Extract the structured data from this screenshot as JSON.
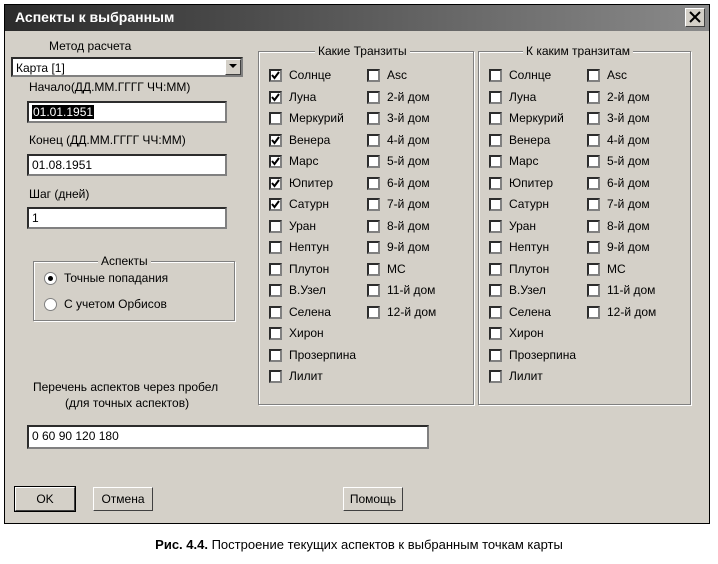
{
  "window": {
    "title": "Аспекты к выбранным"
  },
  "method": {
    "label": "Метод расчета",
    "value": "Карта [1]"
  },
  "start": {
    "label": "Начало(ДД.ММ.ГГГГ ЧЧ:ММ)",
    "value": "01.01.1951"
  },
  "end": {
    "label": "Конец (ДД.ММ.ГГГГ ЧЧ:ММ)",
    "value": "01.08.1951"
  },
  "step": {
    "label": "Шаг (дней)",
    "value": "1"
  },
  "aspects": {
    "title": "Аспекты",
    "options": [
      {
        "label": "Точные попадания",
        "selected": true
      },
      {
        "label": "С учетом Орбисов",
        "selected": false
      }
    ]
  },
  "aspect_list": {
    "label1": "Перечень аспектов через пробел",
    "label2": "(для точных аспектов)",
    "value": "0 60 90 120  180"
  },
  "transits": {
    "title": "Какие Транзиты",
    "col1": [
      {
        "label": "Солнце",
        "checked": true
      },
      {
        "label": "Луна",
        "checked": true
      },
      {
        "label": "Меркурий",
        "checked": false
      },
      {
        "label": "Венера",
        "checked": true
      },
      {
        "label": "Марс",
        "checked": true
      },
      {
        "label": "Юпитер",
        "checked": true
      },
      {
        "label": "Сатурн",
        "checked": true
      },
      {
        "label": "Уран",
        "checked": false
      },
      {
        "label": "Нептун",
        "checked": false
      },
      {
        "label": "Плутон",
        "checked": false
      },
      {
        "label": "В.Узел",
        "checked": false
      },
      {
        "label": "Селена",
        "checked": false
      },
      {
        "label": "Хирон",
        "checked": false
      },
      {
        "label": "Прозерпина",
        "checked": false
      },
      {
        "label": "Лилит",
        "checked": false
      }
    ],
    "col2": [
      {
        "label": "Asc",
        "checked": false
      },
      {
        "label": "2-й дом",
        "checked": false
      },
      {
        "label": "3-й дом",
        "checked": false
      },
      {
        "label": "4-й дом",
        "checked": false
      },
      {
        "label": "5-й дом",
        "checked": false
      },
      {
        "label": "6-й дом",
        "checked": false
      },
      {
        "label": "7-й дом",
        "checked": false
      },
      {
        "label": "8-й дом",
        "checked": false
      },
      {
        "label": "9-й дом",
        "checked": false
      },
      {
        "label": "MC",
        "checked": false
      },
      {
        "label": "11-й дом",
        "checked": false
      },
      {
        "label": "12-й дом",
        "checked": false
      }
    ]
  },
  "targets": {
    "title": "К каким транзитам",
    "col1": [
      {
        "label": "Солнце",
        "checked": false
      },
      {
        "label": "Луна",
        "checked": false
      },
      {
        "label": "Меркурий",
        "checked": false
      },
      {
        "label": "Венера",
        "checked": false
      },
      {
        "label": "Марс",
        "checked": false
      },
      {
        "label": "Юпитер",
        "checked": false
      },
      {
        "label": "Сатурн",
        "checked": false
      },
      {
        "label": "Уран",
        "checked": false
      },
      {
        "label": "Нептун",
        "checked": false
      },
      {
        "label": "Плутон",
        "checked": false
      },
      {
        "label": "В.Узел",
        "checked": false
      },
      {
        "label": "Селена",
        "checked": false
      },
      {
        "label": "Хирон",
        "checked": false
      },
      {
        "label": "Прозерпина",
        "checked": false
      },
      {
        "label": "Лилит",
        "checked": false
      }
    ],
    "col2": [
      {
        "label": "Asc",
        "checked": false
      },
      {
        "label": "2-й дом",
        "checked": false
      },
      {
        "label": "3-й дом",
        "checked": false
      },
      {
        "label": "4-й дом",
        "checked": false
      },
      {
        "label": "5-й дом",
        "checked": false
      },
      {
        "label": "6-й дом",
        "checked": false
      },
      {
        "label": "7-й дом",
        "checked": false
      },
      {
        "label": "8-й дом",
        "checked": false
      },
      {
        "label": "9-й дом",
        "checked": false
      },
      {
        "label": "MC",
        "checked": false
      },
      {
        "label": "11-й дом",
        "checked": false
      },
      {
        "label": "12-й дом",
        "checked": false
      }
    ]
  },
  "buttons": {
    "ok": "OK",
    "cancel": "Отмена",
    "help": "Помощь"
  },
  "caption": {
    "bold": "Рис. 4.4.",
    "text": " Построение текущих аспектов к выбранным точкам карты"
  }
}
